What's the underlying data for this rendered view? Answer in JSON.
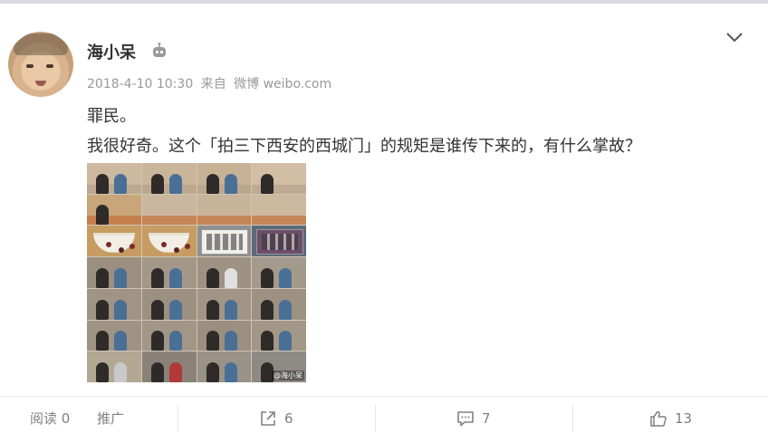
{
  "user": {
    "name": "海小呆",
    "verified_icon": "robot-icon"
  },
  "post": {
    "timestamp": "2018-4-10 10:30",
    "source_prefix": "来自",
    "source": "微博 weibo.com",
    "lines": [
      "罪民。",
      "我很好奇。这个「拍三下西安的西城门」的规矩是谁传下来的，有什么掌故？"
    ],
    "image_watermark": "@海小呆"
  },
  "actions": {
    "read_label": "阅读",
    "read_count": "0",
    "promote_label": "推广",
    "share_count": "6",
    "comment_count": "7",
    "like_count": "13"
  },
  "colors": {
    "text": "#333333",
    "meta": "#999999",
    "action": "#808080",
    "topline": "#d8d8de"
  },
  "icons": [
    "chevron-down-icon",
    "share-icon",
    "comment-icon",
    "like-icon",
    "robot-icon"
  ]
}
